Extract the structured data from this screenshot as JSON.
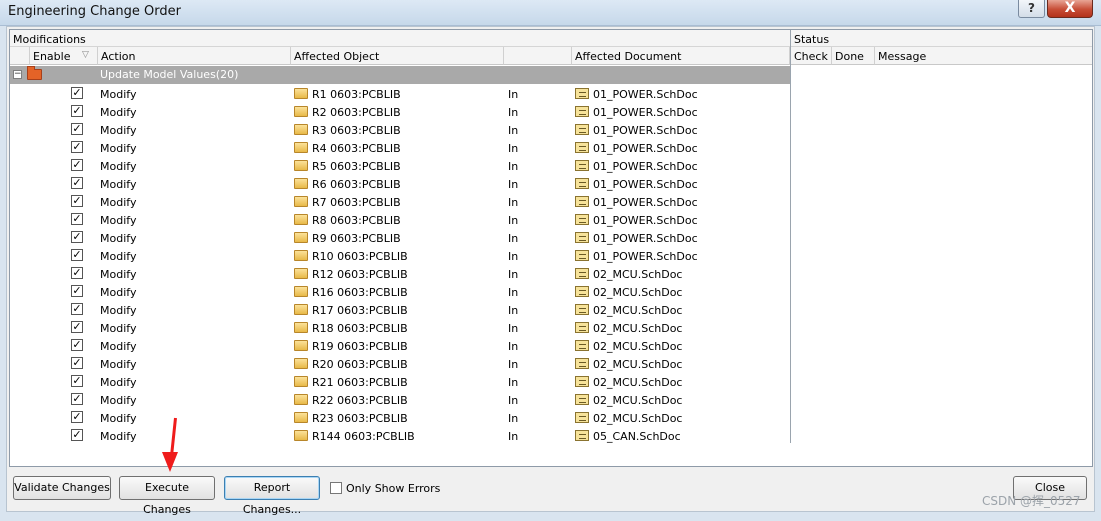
{
  "window": {
    "title": "Engineering Change Order",
    "help_glyph": "?",
    "close_glyph": "X"
  },
  "grid": {
    "group_headers": {
      "modifications": "Modifications",
      "status": "Status"
    },
    "columns": {
      "enable": "Enable",
      "action": "Action",
      "affected_object": "Affected Object",
      "affected_document": "Affected Document",
      "check": "Check",
      "done": "Done",
      "message": "Message"
    },
    "group_row": {
      "label": "Update Model Values(20)",
      "expander": "−"
    },
    "rows": [
      {
        "enabled": true,
        "action": "Modify",
        "object": "R1 0603:PCBLIB",
        "direction": "In",
        "document": "01_POWER.SchDoc"
      },
      {
        "enabled": true,
        "action": "Modify",
        "object": "R2 0603:PCBLIB",
        "direction": "In",
        "document": "01_POWER.SchDoc"
      },
      {
        "enabled": true,
        "action": "Modify",
        "object": "R3 0603:PCBLIB",
        "direction": "In",
        "document": "01_POWER.SchDoc"
      },
      {
        "enabled": true,
        "action": "Modify",
        "object": "R4 0603:PCBLIB",
        "direction": "In",
        "document": "01_POWER.SchDoc"
      },
      {
        "enabled": true,
        "action": "Modify",
        "object": "R5 0603:PCBLIB",
        "direction": "In",
        "document": "01_POWER.SchDoc"
      },
      {
        "enabled": true,
        "action": "Modify",
        "object": "R6 0603:PCBLIB",
        "direction": "In",
        "document": "01_POWER.SchDoc"
      },
      {
        "enabled": true,
        "action": "Modify",
        "object": "R7 0603:PCBLIB",
        "direction": "In",
        "document": "01_POWER.SchDoc"
      },
      {
        "enabled": true,
        "action": "Modify",
        "object": "R8 0603:PCBLIB",
        "direction": "In",
        "document": "01_POWER.SchDoc"
      },
      {
        "enabled": true,
        "action": "Modify",
        "object": "R9 0603:PCBLIB",
        "direction": "In",
        "document": "01_POWER.SchDoc"
      },
      {
        "enabled": true,
        "action": "Modify",
        "object": "R10 0603:PCBLIB",
        "direction": "In",
        "document": "01_POWER.SchDoc"
      },
      {
        "enabled": true,
        "action": "Modify",
        "object": "R12 0603:PCBLIB",
        "direction": "In",
        "document": "02_MCU.SchDoc"
      },
      {
        "enabled": true,
        "action": "Modify",
        "object": "R16 0603:PCBLIB",
        "direction": "In",
        "document": "02_MCU.SchDoc"
      },
      {
        "enabled": true,
        "action": "Modify",
        "object": "R17 0603:PCBLIB",
        "direction": "In",
        "document": "02_MCU.SchDoc"
      },
      {
        "enabled": true,
        "action": "Modify",
        "object": "R18 0603:PCBLIB",
        "direction": "In",
        "document": "02_MCU.SchDoc"
      },
      {
        "enabled": true,
        "action": "Modify",
        "object": "R19 0603:PCBLIB",
        "direction": "In",
        "document": "02_MCU.SchDoc"
      },
      {
        "enabled": true,
        "action": "Modify",
        "object": "R20 0603:PCBLIB",
        "direction": "In",
        "document": "02_MCU.SchDoc"
      },
      {
        "enabled": true,
        "action": "Modify",
        "object": "R21 0603:PCBLIB",
        "direction": "In",
        "document": "02_MCU.SchDoc"
      },
      {
        "enabled": true,
        "action": "Modify",
        "object": "R22 0603:PCBLIB",
        "direction": "In",
        "document": "02_MCU.SchDoc"
      },
      {
        "enabled": true,
        "action": "Modify",
        "object": "R23 0603:PCBLIB",
        "direction": "In",
        "document": "02_MCU.SchDoc"
      },
      {
        "enabled": true,
        "action": "Modify",
        "object": "R144 0603:PCBLIB",
        "direction": "In",
        "document": "05_CAN.SchDoc"
      }
    ]
  },
  "buttons": {
    "validate": "Validate Changes",
    "execute": "Execute Changes",
    "report": "Report Changes...",
    "close": "Close"
  },
  "only_show_errors": {
    "label": "Only Show Errors",
    "checked": false
  },
  "icons": {
    "group_folder": "red-folder-icon",
    "object_folder": "folder-icon",
    "document": "schematic-doc-icon",
    "annotation": "red-arrow"
  },
  "colors": {
    "group_row_bg": "#a9a9a9",
    "annotation_arrow": "#ef1c1c"
  },
  "watermark": "CSDN @挥_0527"
}
